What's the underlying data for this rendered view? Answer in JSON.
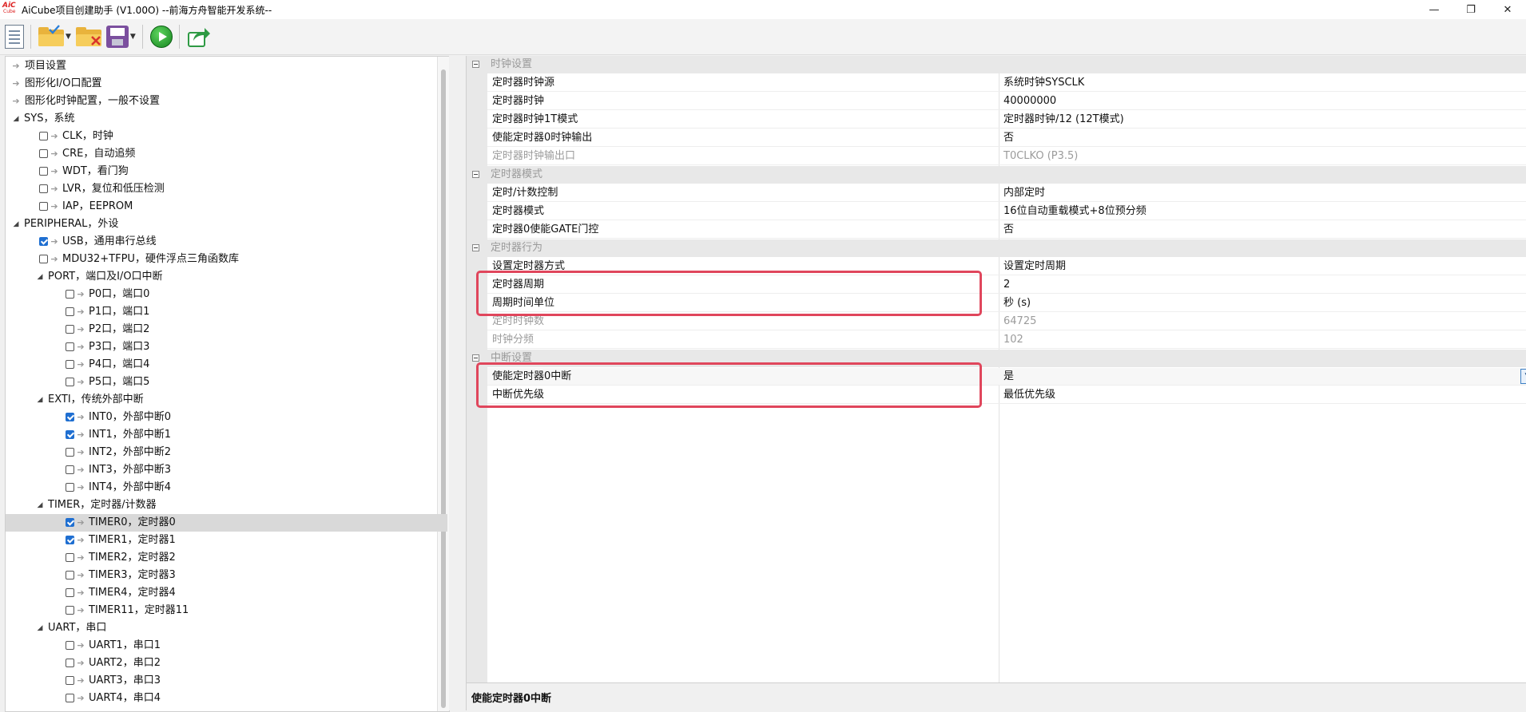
{
  "window": {
    "logo_line1": "AiC",
    "logo_line2": "Cube",
    "title": "AiCube项目创建助手 (V1.00O) --前海方舟智能开发系统--",
    "controls": [
      {
        "name": "minimize-button",
        "glyph": "—"
      },
      {
        "name": "restore-button",
        "glyph": "❐"
      },
      {
        "name": "close-button",
        "glyph": "✕"
      }
    ]
  },
  "toolbar": {
    "buttons": [
      {
        "name": "new-project-button",
        "icon": "new-document-icon"
      },
      {
        "name": "open-project-button",
        "icon": "open-folder-icon",
        "dropdown": true
      },
      {
        "name": "close-project-button",
        "icon": "close-folder-icon"
      },
      {
        "name": "save-project-button",
        "icon": "save-icon",
        "dropdown": true
      },
      {
        "name": "run-button",
        "icon": "run-icon"
      },
      {
        "name": "export-button",
        "icon": "export-icon"
      }
    ],
    "dropdown_glyph": "▼"
  },
  "tree": {
    "items": [
      {
        "label": "项目设置",
        "level": 0,
        "type": "leaf"
      },
      {
        "label": "图形化I/O口配置",
        "level": 0,
        "type": "leaf"
      },
      {
        "label": "图形化时钟配置，一般不设置",
        "level": 0,
        "type": "leaf"
      },
      {
        "label": "SYS，系统",
        "level": 0,
        "type": "group"
      },
      {
        "label": "CLK，时钟",
        "level": 1,
        "type": "check",
        "checked": false
      },
      {
        "label": "CRE，自动追频",
        "level": 1,
        "type": "check",
        "checked": false
      },
      {
        "label": "WDT，看门狗",
        "level": 1,
        "type": "check",
        "checked": false
      },
      {
        "label": "LVR，复位和低压检测",
        "level": 1,
        "type": "check",
        "checked": false
      },
      {
        "label": "IAP，EEPROM",
        "level": 1,
        "type": "check",
        "checked": false
      },
      {
        "label": "PERIPHERAL，外设",
        "level": 0,
        "type": "group"
      },
      {
        "label": "USB，通用串行总线",
        "level": 1,
        "type": "check",
        "checked": true
      },
      {
        "label": "MDU32+TFPU，硬件浮点三角函数库",
        "level": 1,
        "type": "check",
        "checked": false
      },
      {
        "label": "PORT，端口及I/O口中断",
        "level": 1,
        "type": "group"
      },
      {
        "label": "P0口，端口0",
        "level": 2,
        "type": "check",
        "checked": false
      },
      {
        "label": "P1口，端口1",
        "level": 2,
        "type": "check",
        "checked": false
      },
      {
        "label": "P2口，端口2",
        "level": 2,
        "type": "check",
        "checked": false
      },
      {
        "label": "P3口，端口3",
        "level": 2,
        "type": "check",
        "checked": false
      },
      {
        "label": "P4口，端口4",
        "level": 2,
        "type": "check",
        "checked": false
      },
      {
        "label": "P5口，端口5",
        "level": 2,
        "type": "check",
        "checked": false
      },
      {
        "label": "EXTI，传统外部中断",
        "level": 1,
        "type": "group"
      },
      {
        "label": "INT0，外部中断0",
        "level": 2,
        "type": "check",
        "checked": true
      },
      {
        "label": "INT1，外部中断1",
        "level": 2,
        "type": "check",
        "checked": true
      },
      {
        "label": "INT2，外部中断2",
        "level": 2,
        "type": "check",
        "checked": false
      },
      {
        "label": "INT3，外部中断3",
        "level": 2,
        "type": "check",
        "checked": false
      },
      {
        "label": "INT4，外部中断4",
        "level": 2,
        "type": "check",
        "checked": false
      },
      {
        "label": "TIMER，定时器/计数器",
        "level": 1,
        "type": "group"
      },
      {
        "label": "TIMER0，定时器0",
        "level": 2,
        "type": "check",
        "checked": true,
        "selected": true
      },
      {
        "label": "TIMER1，定时器1",
        "level": 2,
        "type": "check",
        "checked": true
      },
      {
        "label": "TIMER2，定时器2",
        "level": 2,
        "type": "check",
        "checked": false
      },
      {
        "label": "TIMER3，定时器3",
        "level": 2,
        "type": "check",
        "checked": false
      },
      {
        "label": "TIMER4，定时器4",
        "level": 2,
        "type": "check",
        "checked": false
      },
      {
        "label": "TIMER11，定时器11",
        "level": 2,
        "type": "check",
        "checked": false
      },
      {
        "label": "UART，串口",
        "level": 1,
        "type": "group"
      },
      {
        "label": "UART1，串口1",
        "level": 2,
        "type": "check",
        "checked": false
      },
      {
        "label": "UART2，串口2",
        "level": 2,
        "type": "check",
        "checked": false
      },
      {
        "label": "UART3，串口3",
        "level": 2,
        "type": "check",
        "checked": false
      },
      {
        "label": "UART4，串口4",
        "level": 2,
        "type": "check",
        "checked": false
      }
    ],
    "expand_glyph": "◢",
    "leaf_glyph": "➔"
  },
  "properties": {
    "categories": [
      {
        "label": "时钟设置",
        "rows": [
          {
            "name": "定时器时钟源",
            "value": "系统时钟SYSCLK"
          },
          {
            "name": "定时器时钟",
            "value": "40000000"
          },
          {
            "name": "定时器时钟1T模式",
            "value": "定时器时钟/12 (12T模式)"
          },
          {
            "name": "使能定时器0时钟输出",
            "value": "否"
          },
          {
            "name": "定时器时钟输出口",
            "value": "T0CLKO (P3.5)",
            "disabled": true
          }
        ]
      },
      {
        "label": "定时器模式",
        "rows": [
          {
            "name": "定时/计数控制",
            "value": "内部定时"
          },
          {
            "name": "定时器模式",
            "value": "16位自动重载模式+8位预分频"
          },
          {
            "name": "定时器0使能GATE门控",
            "value": "否"
          }
        ]
      },
      {
        "label": "定时器行为",
        "rows": [
          {
            "name": "设置定时器方式",
            "value": "设置定时周期"
          },
          {
            "name": "定时器周期",
            "value": "2"
          },
          {
            "name": "周期时间单位",
            "value": "秒 (s)"
          },
          {
            "name": "定时时钟数",
            "value": "64725",
            "disabled": true
          },
          {
            "name": "时钟分频",
            "value": "102",
            "disabled": true
          }
        ]
      },
      {
        "label": "中断设置",
        "rows": [
          {
            "name": "使能定时器0中断",
            "value": "是",
            "active": true
          },
          {
            "name": "中断优先级",
            "value": "最低优先级"
          }
        ]
      }
    ],
    "dropdown_glyph": "▼",
    "description_title": "使能定时器0中断",
    "highlight_color": "#e0465c"
  }
}
